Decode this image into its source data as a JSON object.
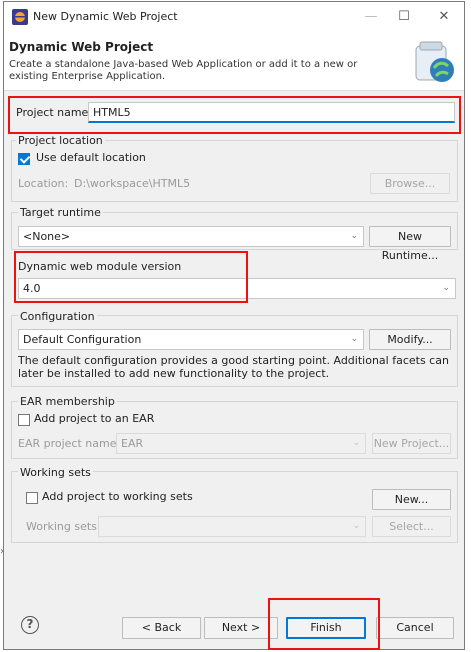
{
  "window": {
    "title": "New Dynamic Web Project",
    "minimize": "—",
    "maximize": "☐",
    "close": "✕"
  },
  "header": {
    "title": "Dynamic Web Project",
    "description": "Create a standalone Java-based Web Application or add it to a new or existing Enterprise Application."
  },
  "project": {
    "name_label": "Project name:",
    "name_value": "HTML5"
  },
  "location": {
    "group_label": "Project location",
    "use_default_label": "Use default location",
    "use_default_checked": true,
    "location_label": "Location:",
    "location_value": "D:\\workspace\\HTML5",
    "browse_label": "Browse..."
  },
  "runtime": {
    "group_label": "Target runtime",
    "selected": "<None>",
    "new_runtime_label": "New Runtime..."
  },
  "module_version": {
    "label": "Dynamic web module version",
    "selected": "4.0"
  },
  "configuration": {
    "group_label": "Configuration",
    "selected": "Default Configuration",
    "modify_label": "Modify...",
    "description": "The default configuration provides a good starting point. Additional facets can later be installed to add new functionality to the project."
  },
  "ear": {
    "group_label": "EAR membership",
    "add_label": "Add project to an EAR",
    "add_checked": false,
    "project_name_label": "EAR project name:",
    "project_name_value": "EAR",
    "new_project_label": "New Project..."
  },
  "working_sets": {
    "group_label": "Working sets",
    "add_label": "Add project to working sets",
    "add_checked": false,
    "new_label": "New...",
    "sets_label": "Working sets:",
    "sets_value": "",
    "select_label": "Select..."
  },
  "footer": {
    "help": "?",
    "back_label": "< Back",
    "next_label": "Next >",
    "finish_label": "Finish",
    "cancel_label": "Cancel"
  },
  "colors": {
    "highlight": "#e11111",
    "accent": "#0078d7"
  }
}
